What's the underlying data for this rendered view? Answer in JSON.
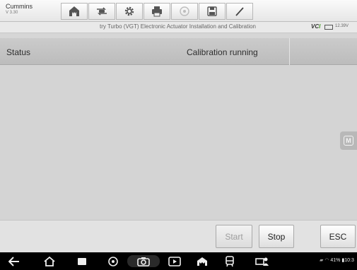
{
  "brand": {
    "name": "Cummins",
    "version": "V 3.30"
  },
  "toolbar": {
    "buttons": [
      {
        "icon": "home-icon"
      },
      {
        "icon": "vehicle-swap-icon"
      },
      {
        "icon": "settings-gear-icon"
      },
      {
        "icon": "printer-icon"
      },
      {
        "icon": "help-icon"
      },
      {
        "icon": "save-icon"
      },
      {
        "icon": "pen-icon"
      }
    ]
  },
  "subheader": {
    "title": "try Turbo (VGT) Electronic Actuator Installation and Calibration",
    "vci": {
      "prefix": "VC",
      "suffix": "I"
    },
    "voltage": "12.39V"
  },
  "status": {
    "label": "Status",
    "value": "Calibration running"
  },
  "side_tab": {
    "label": "M"
  },
  "actions": {
    "start": "Start",
    "stop": "Stop",
    "esc": "ESC"
  },
  "system_bar": {
    "icons": [
      "back-icon",
      "home-icon",
      "recent-apps-icon",
      "browser-icon",
      "camera-icon",
      "screenshot-icon",
      "vehicle-home-icon",
      "vci-icon",
      "remote-desktop-icon"
    ],
    "battery_percent": "41%",
    "time": "10:3"
  },
  "colors": {
    "vci_green": "#4aa02c",
    "start_disabled": "#9e9e9e"
  }
}
